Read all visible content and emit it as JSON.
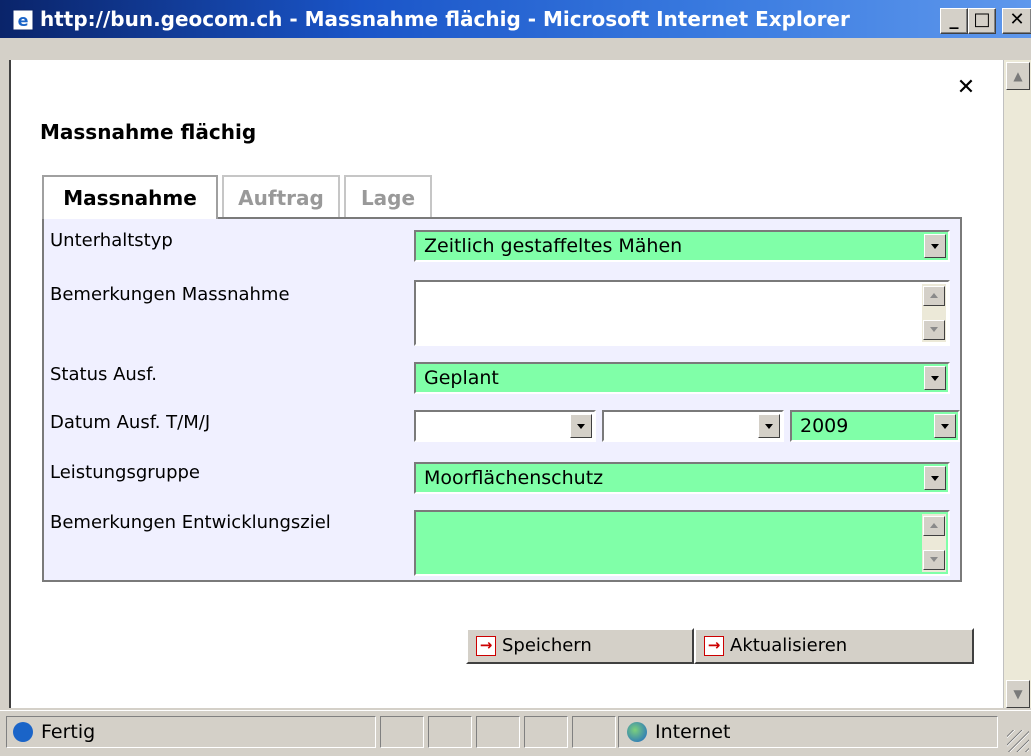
{
  "window": {
    "title": "http://bun.geocom.ch - Massnahme flächig - Microsoft Internet Explorer",
    "min_label": "_",
    "max_label": "□",
    "close_label": "✕"
  },
  "dialog": {
    "close_label": "✕",
    "title": "Massnahme flächig"
  },
  "tabs": [
    {
      "label": "Massnahme"
    },
    {
      "label": "Auftrag"
    },
    {
      "label": "Lage"
    }
  ],
  "form": {
    "unterhaltstyp": {
      "label": "Unterhaltstyp",
      "value": "Zeitlich gestaffeltes Mähen"
    },
    "bemerkungen_massnahme": {
      "label": "Bemerkungen Massnahme",
      "value": ""
    },
    "status": {
      "label": "Status Ausf.",
      "value": "Geplant"
    },
    "datum": {
      "label": "Datum Ausf. T/M/J",
      "day": "",
      "month": "",
      "year": "2009"
    },
    "leistungsgruppe": {
      "label": "Leistungsgruppe",
      "value": "Moorflächenschutz"
    },
    "bemerkungen_entwicklungsziel": {
      "label": "Bemerkungen Entwicklungsziel",
      "value": ""
    }
  },
  "buttons": {
    "save": "Speichern",
    "refresh": "Aktualisieren"
  },
  "statusbar": {
    "status": "Fertig",
    "zone": "Internet"
  },
  "colors": {
    "required_field": "#80ffa8",
    "panel_bg": "#f0f0ff"
  }
}
